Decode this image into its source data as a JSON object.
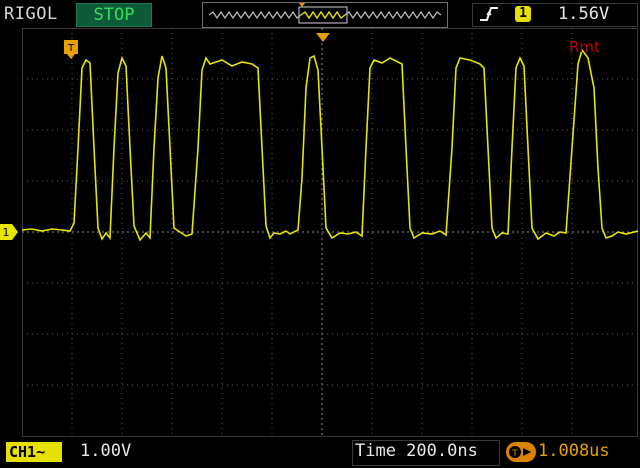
{
  "header": {
    "brand": "RIGOL",
    "run_state": "STOP",
    "trigger": {
      "edge_icon": "rising-edge-icon",
      "channel": "1",
      "level": "1.56V"
    }
  },
  "status": {
    "remote": "Rmt"
  },
  "footer": {
    "channel_label": "CH1~",
    "channel_scale": "1.00V",
    "timebase": "Time 200.0ns",
    "trigger_offset": "1.008us"
  },
  "markers": {
    "channel_marker": "1",
    "trigger_pos_marker": "T"
  },
  "colors": {
    "trace": "#e6e600",
    "grid": "#5a5a5a",
    "stop_bg": "#0f5a3a",
    "stop_text": "#33e05b",
    "offset": "#d88400",
    "remote": "#c00000"
  }
}
